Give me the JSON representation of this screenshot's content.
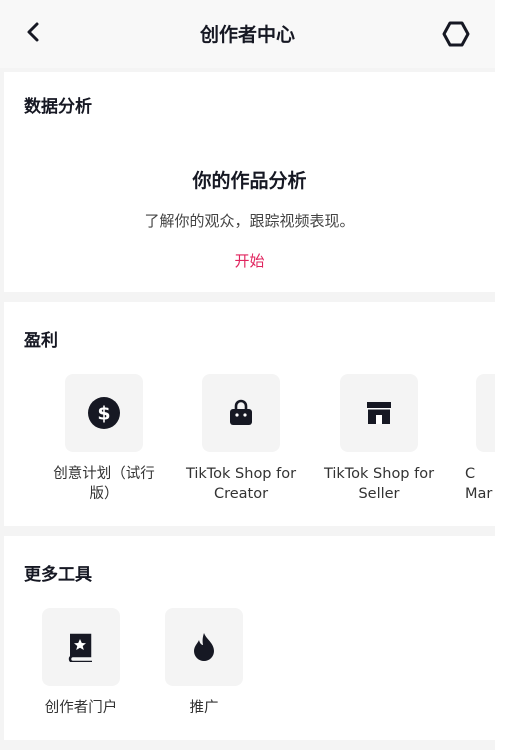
{
  "header": {
    "title": "创作者中心"
  },
  "analytics": {
    "section_title": "数据分析",
    "headline": "你的作品分析",
    "subtitle": "了解你的观众，跟踪视频表现。",
    "start_label": "开始"
  },
  "monetization": {
    "section_title": "盈利",
    "items": [
      {
        "label": "创意计划（试行版）",
        "icon": "dollar-icon"
      },
      {
        "label": "TikTok Shop for Creator",
        "icon": "shopping-bag-icon"
      },
      {
        "label": "TikTok Shop for Seller",
        "icon": "store-icon"
      },
      {
        "label": "C Mar",
        "icon": ""
      }
    ]
  },
  "tools": {
    "section_title": "更多工具",
    "items": [
      {
        "label": "创作者门户",
        "icon": "book-star-icon"
      },
      {
        "label": "推广",
        "icon": "flame-icon"
      }
    ]
  },
  "colors": {
    "accent": "#e0245e",
    "text": "#161823",
    "background": "#f4f4f4"
  }
}
